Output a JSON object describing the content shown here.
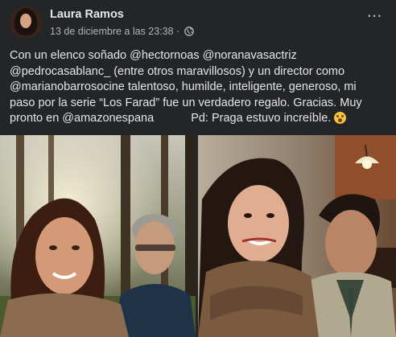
{
  "post": {
    "author": "Laura Ramos",
    "timestamp": "13 de diciembre a las 23:38 ·",
    "privacy_icon": "globe-icon",
    "more_icon": "more-horizontal-icon",
    "more_label": "···",
    "text_lines": [
      "Con un elenco soñado @hectornoas @noranavasactriz",
      "@pedrocasablanc_  (entre otros maravillosos) y un director como",
      "@marianobarrosocine talentoso, humilde, inteligente, generoso, mi",
      "paso por la serie “Los Farad” fue un verdadero regalo. Gracias.  Muy"
    ],
    "last_line_start": "pronto en @amazonespana",
    "last_line_end": "Pd: Praga estuvo increíble.",
    "emoji": "flushed-face-emoji",
    "photos": [
      {
        "name": "photo-selfie-forest"
      },
      {
        "name": "photo-period-costume"
      }
    ]
  },
  "colors": {
    "background": "#242526",
    "text_primary": "#e4e6eb",
    "text_secondary": "#b0b3b8"
  }
}
